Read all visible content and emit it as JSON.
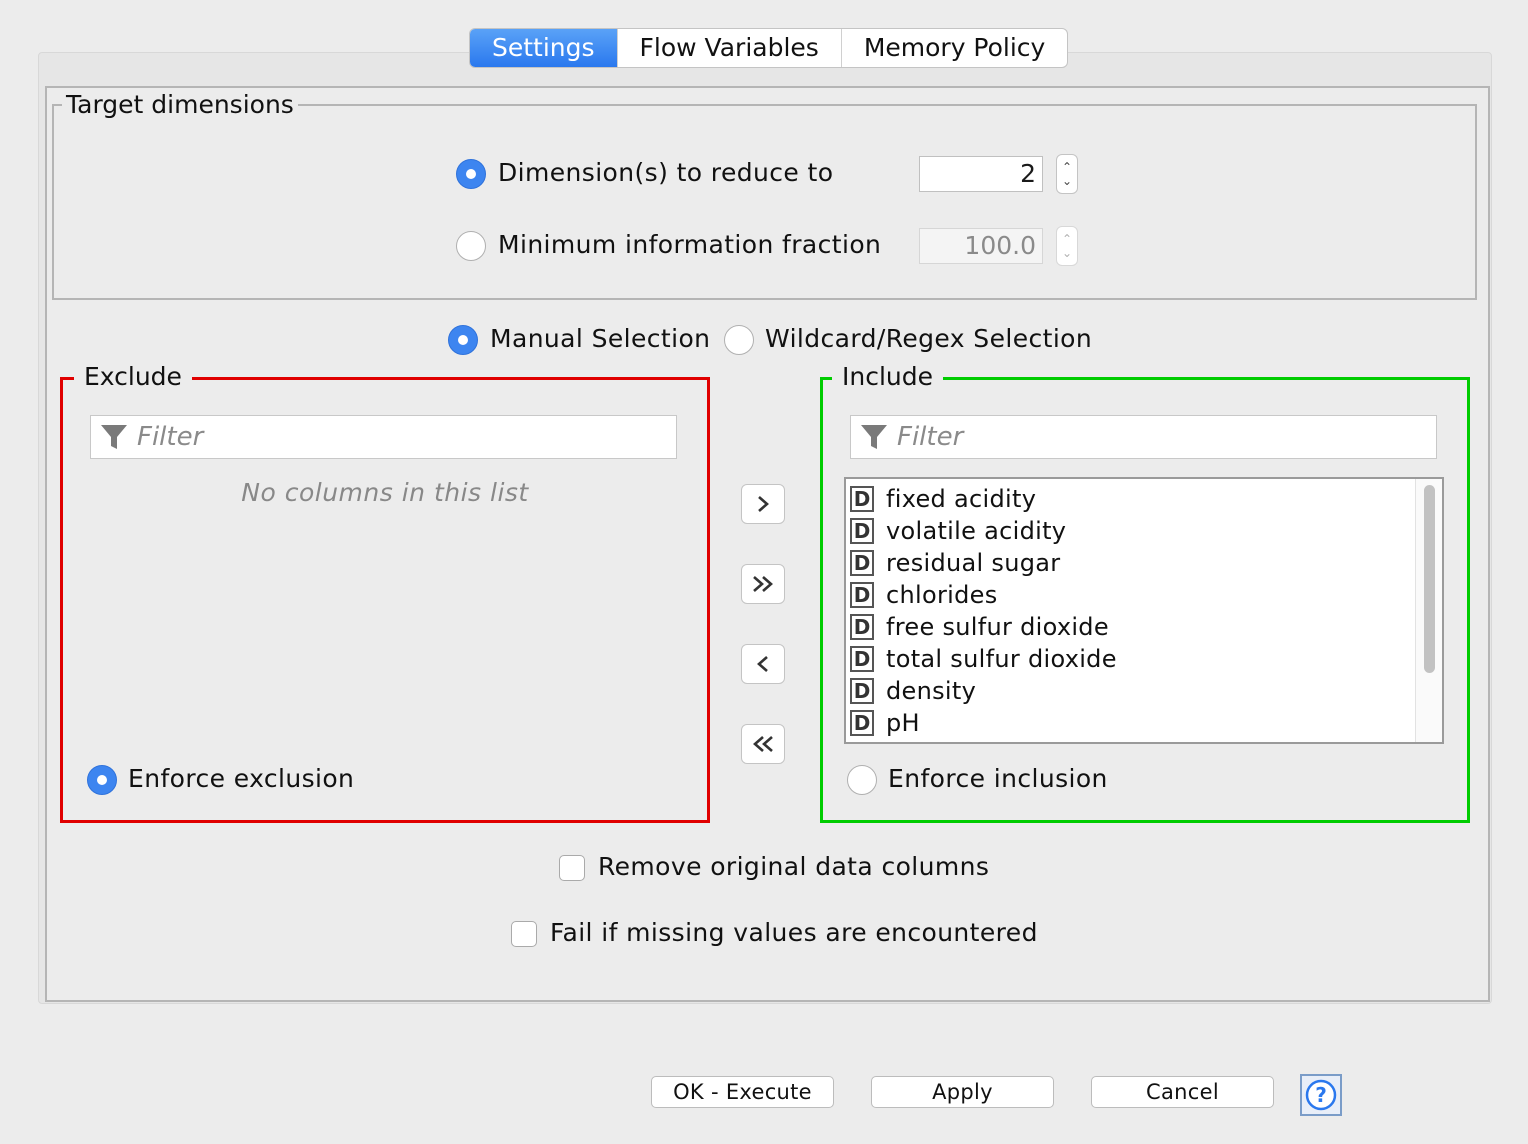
{
  "tabs": [
    {
      "label": "Settings",
      "active": true
    },
    {
      "label": "Flow Variables",
      "active": false
    },
    {
      "label": "Memory Policy",
      "active": false
    }
  ],
  "target_dimensions": {
    "title": "Target dimensions",
    "options": [
      {
        "label": "Dimension(s) to reduce to",
        "selected": true,
        "value": "2",
        "enabled": true
      },
      {
        "label": "Minimum information fraction",
        "selected": false,
        "value": "100.0",
        "enabled": false
      }
    ]
  },
  "selection_mode": {
    "options": [
      {
        "label": "Manual Selection",
        "selected": true
      },
      {
        "label": "Wildcard/Regex Selection",
        "selected": false
      }
    ]
  },
  "exclude": {
    "title": "Exclude",
    "border_color": "#e00000",
    "filter_placeholder": "Filter",
    "empty_message": "No columns in this list",
    "enforce_label": "Enforce exclusion",
    "enforce_selected": true
  },
  "include": {
    "title": "Include",
    "border_color": "#00cc00",
    "filter_placeholder": "Filter",
    "type_badge": "D",
    "columns": [
      "fixed acidity",
      "volatile acidity",
      "residual sugar",
      "chlorides",
      "free sulfur dioxide",
      "total sulfur dioxide",
      "density",
      "pH"
    ],
    "enforce_label": "Enforce inclusion",
    "enforce_selected": false
  },
  "move_buttons": [
    {
      "name": "add-button",
      "glyph": "›"
    },
    {
      "name": "add-all-button",
      "glyph": "»"
    },
    {
      "name": "remove-button",
      "glyph": "‹"
    },
    {
      "name": "remove-all-button",
      "glyph": "«"
    }
  ],
  "options": {
    "remove_original": {
      "label": "Remove original data columns",
      "checked": false
    },
    "fail_missing": {
      "label": "Fail if missing values are encountered",
      "checked": false
    }
  },
  "footer": {
    "ok_label": "OK - Execute",
    "apply_label": "Apply",
    "cancel_label": "Cancel",
    "help_icon": "question-mark"
  },
  "colors": {
    "accent": "#3d85f0",
    "exclude_border": "#e00000",
    "include_border": "#00cc00"
  }
}
